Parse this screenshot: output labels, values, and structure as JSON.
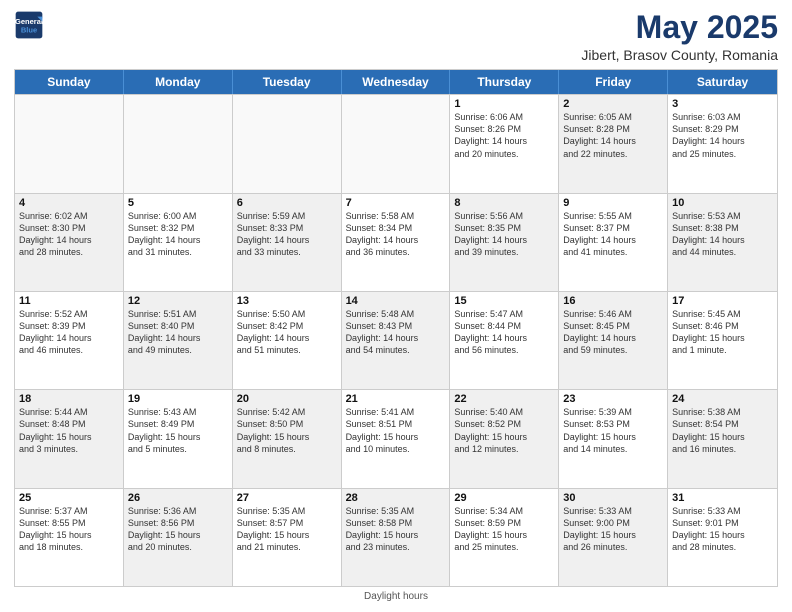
{
  "header": {
    "logo_line1": "General",
    "logo_line2": "Blue",
    "month": "May 2025",
    "location": "Jibert, Brasov County, Romania"
  },
  "weekdays": [
    "Sunday",
    "Monday",
    "Tuesday",
    "Wednesday",
    "Thursday",
    "Friday",
    "Saturday"
  ],
  "rows": [
    [
      {
        "day": "",
        "info": "",
        "empty": true
      },
      {
        "day": "",
        "info": "",
        "empty": true
      },
      {
        "day": "",
        "info": "",
        "empty": true
      },
      {
        "day": "",
        "info": "",
        "empty": true
      },
      {
        "day": "1",
        "info": "Sunrise: 6:06 AM\nSunset: 8:26 PM\nDaylight: 14 hours\nand 20 minutes."
      },
      {
        "day": "2",
        "info": "Sunrise: 6:05 AM\nSunset: 8:28 PM\nDaylight: 14 hours\nand 22 minutes.",
        "shaded": true
      },
      {
        "day": "3",
        "info": "Sunrise: 6:03 AM\nSunset: 8:29 PM\nDaylight: 14 hours\nand 25 minutes."
      }
    ],
    [
      {
        "day": "4",
        "info": "Sunrise: 6:02 AM\nSunset: 8:30 PM\nDaylight: 14 hours\nand 28 minutes.",
        "shaded": true
      },
      {
        "day": "5",
        "info": "Sunrise: 6:00 AM\nSunset: 8:32 PM\nDaylight: 14 hours\nand 31 minutes."
      },
      {
        "day": "6",
        "info": "Sunrise: 5:59 AM\nSunset: 8:33 PM\nDaylight: 14 hours\nand 33 minutes.",
        "shaded": true
      },
      {
        "day": "7",
        "info": "Sunrise: 5:58 AM\nSunset: 8:34 PM\nDaylight: 14 hours\nand 36 minutes."
      },
      {
        "day": "8",
        "info": "Sunrise: 5:56 AM\nSunset: 8:35 PM\nDaylight: 14 hours\nand 39 minutes.",
        "shaded": true
      },
      {
        "day": "9",
        "info": "Sunrise: 5:55 AM\nSunset: 8:37 PM\nDaylight: 14 hours\nand 41 minutes."
      },
      {
        "day": "10",
        "info": "Sunrise: 5:53 AM\nSunset: 8:38 PM\nDaylight: 14 hours\nand 44 minutes.",
        "shaded": true
      }
    ],
    [
      {
        "day": "11",
        "info": "Sunrise: 5:52 AM\nSunset: 8:39 PM\nDaylight: 14 hours\nand 46 minutes."
      },
      {
        "day": "12",
        "info": "Sunrise: 5:51 AM\nSunset: 8:40 PM\nDaylight: 14 hours\nand 49 minutes.",
        "shaded": true
      },
      {
        "day": "13",
        "info": "Sunrise: 5:50 AM\nSunset: 8:42 PM\nDaylight: 14 hours\nand 51 minutes."
      },
      {
        "day": "14",
        "info": "Sunrise: 5:48 AM\nSunset: 8:43 PM\nDaylight: 14 hours\nand 54 minutes.",
        "shaded": true
      },
      {
        "day": "15",
        "info": "Sunrise: 5:47 AM\nSunset: 8:44 PM\nDaylight: 14 hours\nand 56 minutes."
      },
      {
        "day": "16",
        "info": "Sunrise: 5:46 AM\nSunset: 8:45 PM\nDaylight: 14 hours\nand 59 minutes.",
        "shaded": true
      },
      {
        "day": "17",
        "info": "Sunrise: 5:45 AM\nSunset: 8:46 PM\nDaylight: 15 hours\nand 1 minute."
      }
    ],
    [
      {
        "day": "18",
        "info": "Sunrise: 5:44 AM\nSunset: 8:48 PM\nDaylight: 15 hours\nand 3 minutes.",
        "shaded": true
      },
      {
        "day": "19",
        "info": "Sunrise: 5:43 AM\nSunset: 8:49 PM\nDaylight: 15 hours\nand 5 minutes."
      },
      {
        "day": "20",
        "info": "Sunrise: 5:42 AM\nSunset: 8:50 PM\nDaylight: 15 hours\nand 8 minutes.",
        "shaded": true
      },
      {
        "day": "21",
        "info": "Sunrise: 5:41 AM\nSunset: 8:51 PM\nDaylight: 15 hours\nand 10 minutes."
      },
      {
        "day": "22",
        "info": "Sunrise: 5:40 AM\nSunset: 8:52 PM\nDaylight: 15 hours\nand 12 minutes.",
        "shaded": true
      },
      {
        "day": "23",
        "info": "Sunrise: 5:39 AM\nSunset: 8:53 PM\nDaylight: 15 hours\nand 14 minutes."
      },
      {
        "day": "24",
        "info": "Sunrise: 5:38 AM\nSunset: 8:54 PM\nDaylight: 15 hours\nand 16 minutes.",
        "shaded": true
      }
    ],
    [
      {
        "day": "25",
        "info": "Sunrise: 5:37 AM\nSunset: 8:55 PM\nDaylight: 15 hours\nand 18 minutes."
      },
      {
        "day": "26",
        "info": "Sunrise: 5:36 AM\nSunset: 8:56 PM\nDaylight: 15 hours\nand 20 minutes.",
        "shaded": true
      },
      {
        "day": "27",
        "info": "Sunrise: 5:35 AM\nSunset: 8:57 PM\nDaylight: 15 hours\nand 21 minutes."
      },
      {
        "day": "28",
        "info": "Sunrise: 5:35 AM\nSunset: 8:58 PM\nDaylight: 15 hours\nand 23 minutes.",
        "shaded": true
      },
      {
        "day": "29",
        "info": "Sunrise: 5:34 AM\nSunset: 8:59 PM\nDaylight: 15 hours\nand 25 minutes."
      },
      {
        "day": "30",
        "info": "Sunrise: 5:33 AM\nSunset: 9:00 PM\nDaylight: 15 hours\nand 26 minutes.",
        "shaded": true
      },
      {
        "day": "31",
        "info": "Sunrise: 5:33 AM\nSunset: 9:01 PM\nDaylight: 15 hours\nand 28 minutes."
      }
    ]
  ],
  "footer": "Daylight hours"
}
